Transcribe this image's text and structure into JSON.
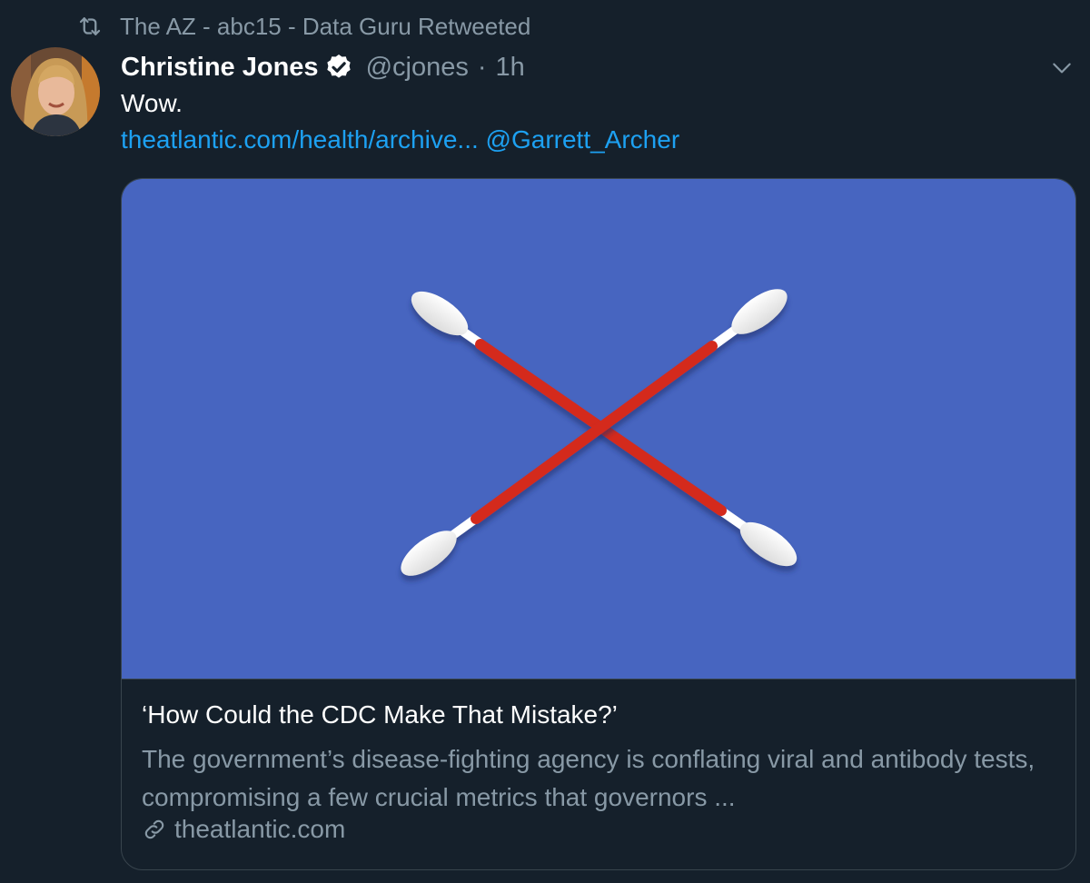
{
  "retweet": {
    "text": "The AZ - abc15 - Data Guru Retweeted",
    "icon": "retweet-icon"
  },
  "tweet": {
    "author_name": "Christine Jones",
    "verified": true,
    "handle": "@cjones",
    "separator": "·",
    "time": "1h",
    "text": "Wow.",
    "link_url_text": "theatlantic.com/health/archive...",
    "mention": "@Garrett_Archer"
  },
  "card": {
    "title": "‘How Could the CDC Make That Mistake?’",
    "description": "The government’s disease-fighting agency is conflating viral and antibody tests, compromising a few crucial metrics that governors ...",
    "domain": "theatlantic.com"
  },
  "colors": {
    "background": "#15202b",
    "accent": "#1da1f2",
    "muted": "#8899a6",
    "card_image_bg": "#4765c0",
    "swab_stick": "#d42b1f"
  }
}
